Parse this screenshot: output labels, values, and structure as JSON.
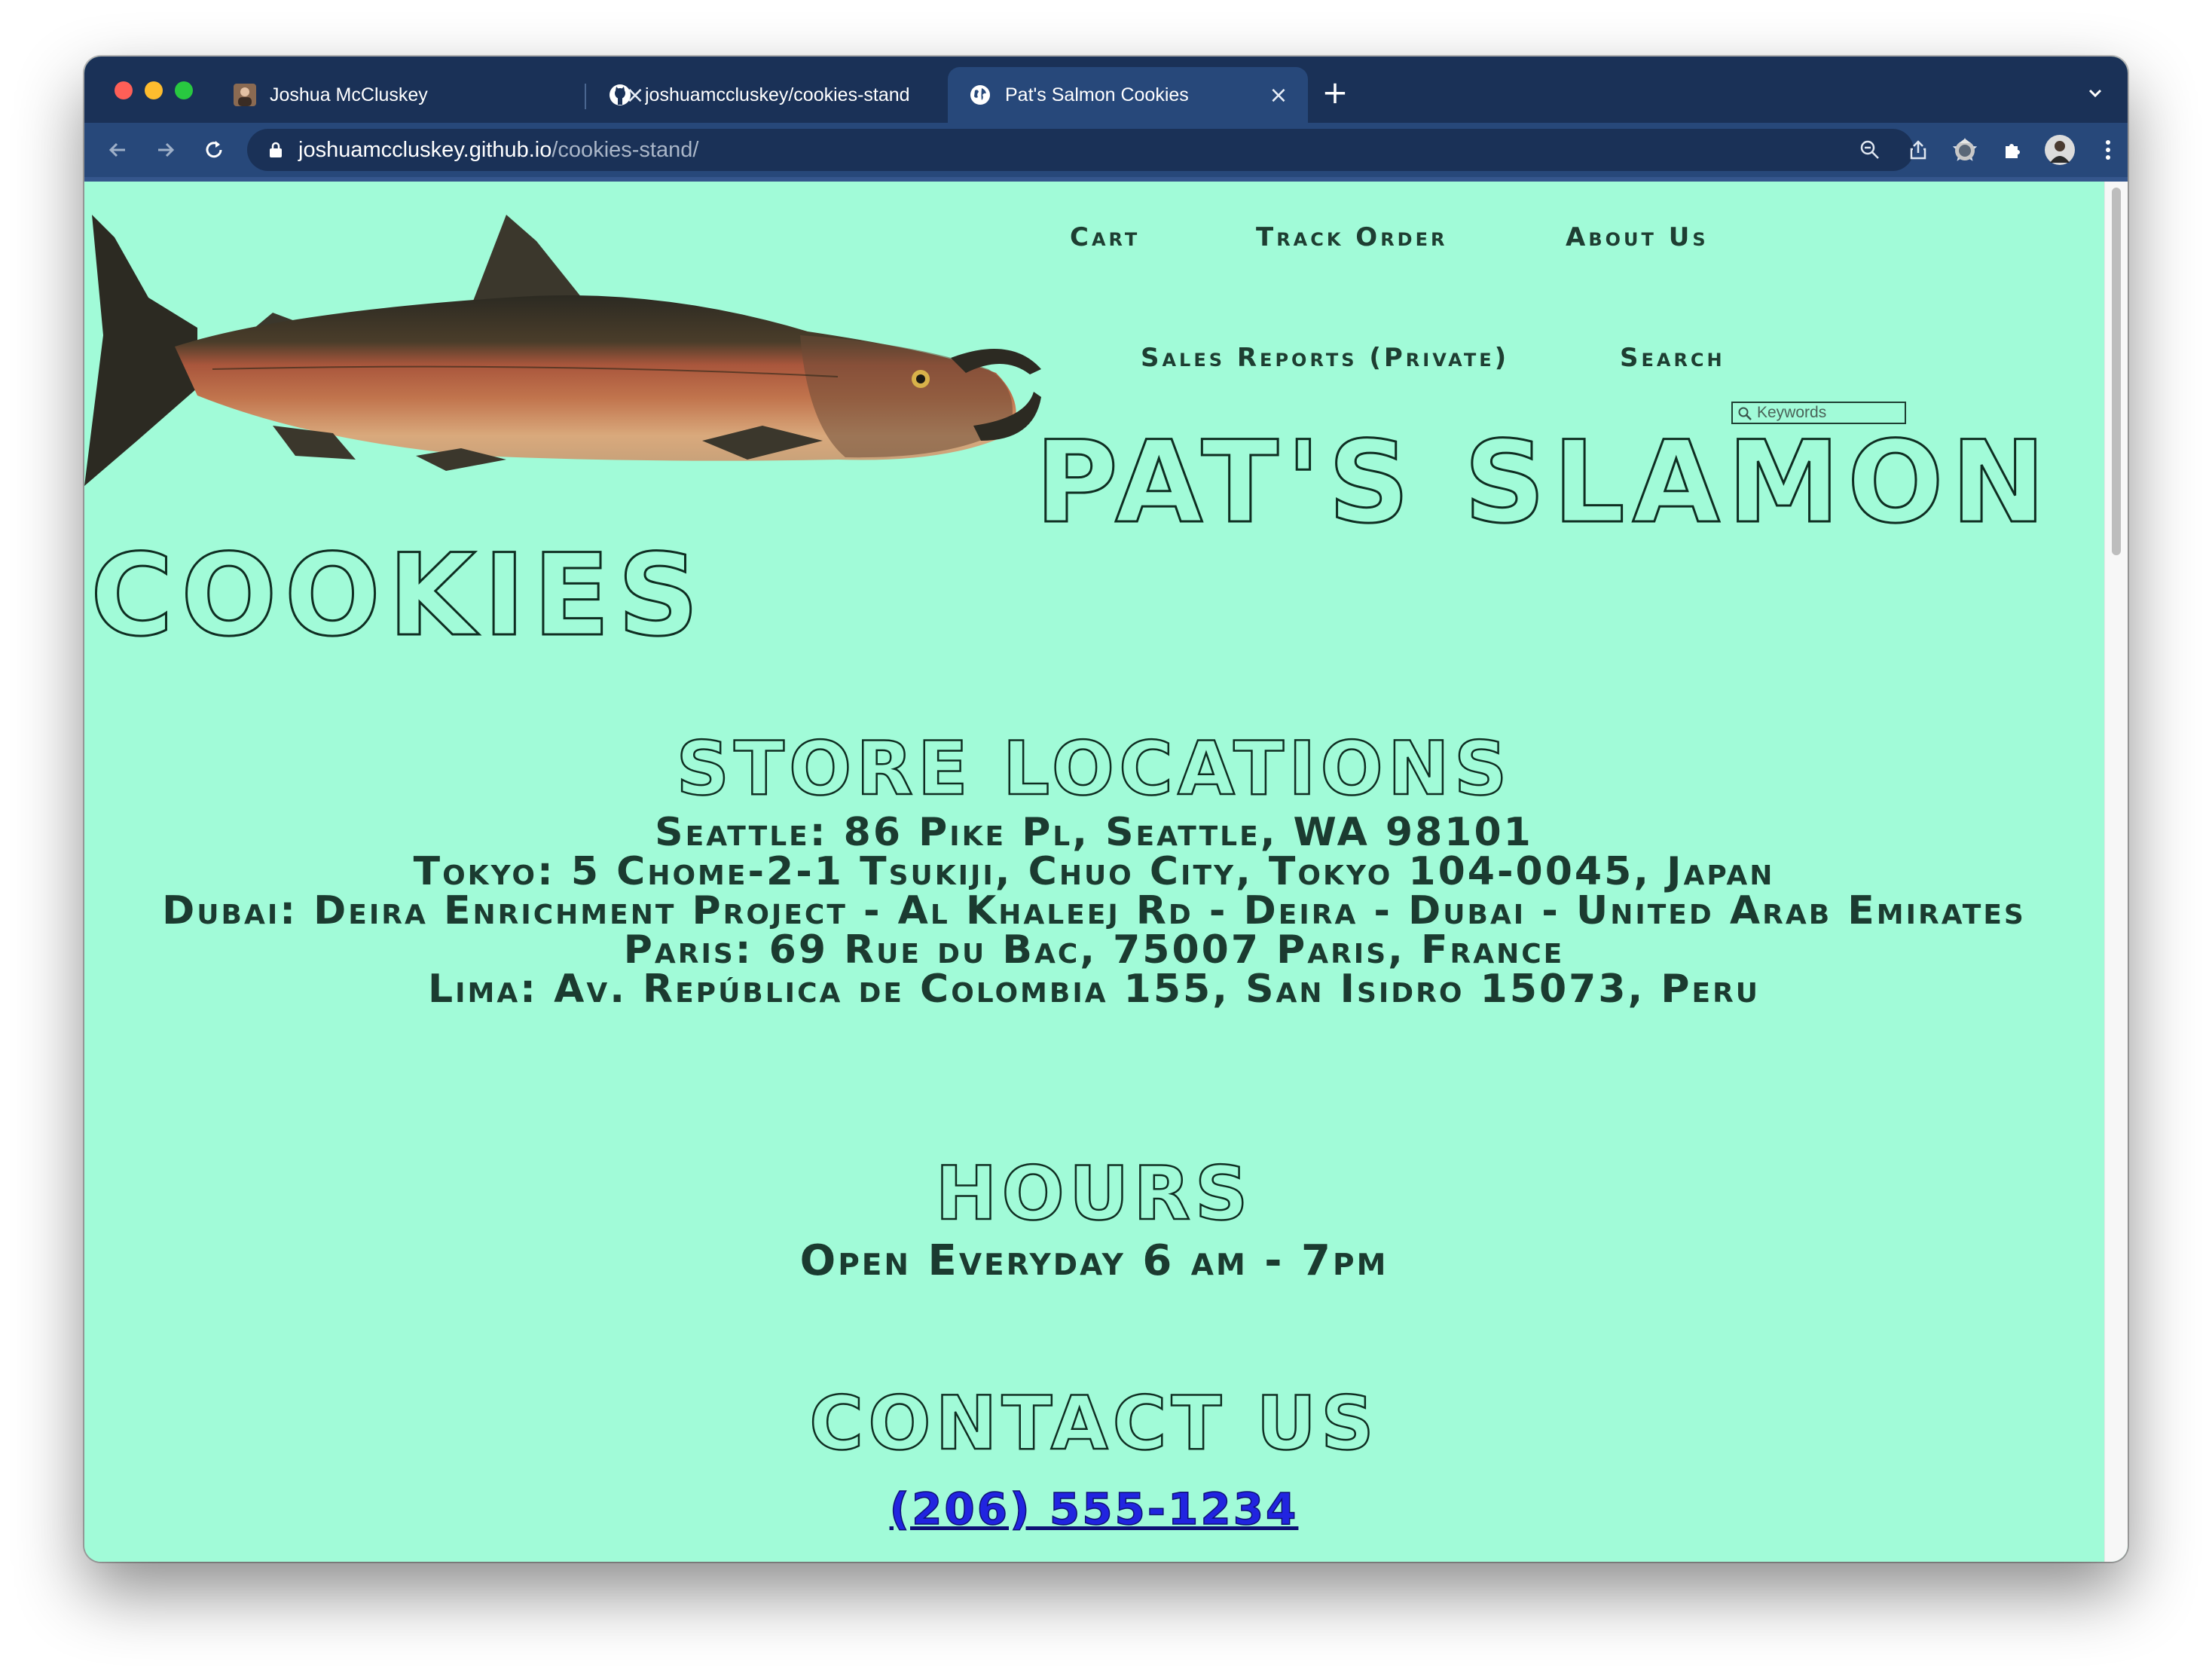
{
  "browser": {
    "tabs": [
      {
        "title": "Joshua McCluskey",
        "favicon": "profile-photo-icon",
        "active": false
      },
      {
        "title": "joshuamccluskey/cookies-stand",
        "favicon": "github-icon",
        "active": false
      },
      {
        "title": "Pat's Salmon Cookies",
        "favicon": "globe-icon",
        "active": true
      }
    ],
    "url_host": "joshuamccluskey.github.io",
    "url_path": "/cookies-stand/"
  },
  "nav": {
    "cart": "Cart",
    "track_order": "Track Order",
    "about_us": "About Us",
    "sales_reports": "Sales Reports (Private)",
    "search_label": "Search",
    "search_placeholder": "Keywords"
  },
  "hero": {
    "title_line1": "PAT'S SLAMON",
    "title_line2": "COOKIES"
  },
  "locations": {
    "heading": "STORE LOCATIONS",
    "items": [
      "Seattle: 86 Pike Pl, Seattle, WA 98101",
      "Tokyo: 5 Chome-2-1 Tsukiji, Chuo City, Tokyo 104-0045, Japan",
      "Dubai: Deira Enrichment Project - Al Khaleej Rd - Deira - Dubai - United Arab Emirates",
      "Paris: 69 Rue du Bac, 75007 Paris, France",
      "Lima: Av. República de Colombia 155, San Isidro 15073, Peru"
    ]
  },
  "hours": {
    "heading": "HOURS",
    "text": "Open Everyday 6 am - 7pm"
  },
  "contact": {
    "heading": "CONTACT US",
    "phone": "(206) 555-1234"
  },
  "colors": {
    "page_background": "#a1fbd8",
    "text_dark": "#1b3b30",
    "link": "#2124e0",
    "browser_frame": "#1a3157"
  }
}
